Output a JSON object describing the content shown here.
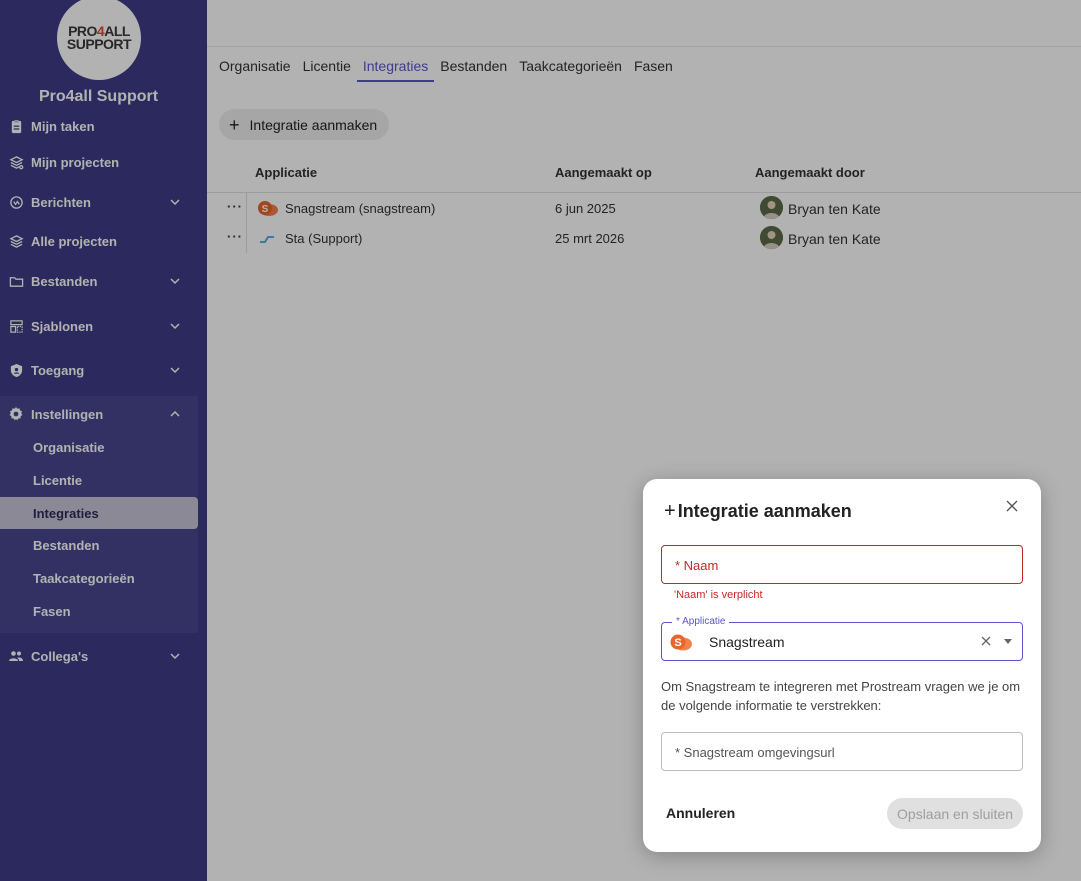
{
  "sidebar": {
    "org_name": "Pro4all Support",
    "logo": {
      "line1_a": "PRO",
      "line1_b": "4",
      "line1_c": "ALL",
      "line2": "SUPPORT"
    },
    "items": [
      {
        "label": "Mijn taken",
        "icon": "clipboard-icon"
      },
      {
        "label": "Mijn projecten",
        "icon": "projects-icon"
      },
      {
        "label": "Berichten",
        "icon": "messages-icon"
      },
      {
        "label": "Alle projecten",
        "icon": "layers-icon"
      },
      {
        "label": "Bestanden",
        "icon": "folder-icon"
      },
      {
        "label": "Sjablonen",
        "icon": "templates-icon"
      },
      {
        "label": "Toegang",
        "icon": "shield-icon"
      },
      {
        "label": "Instellingen",
        "icon": "gear-icon"
      },
      {
        "label": "Collega's",
        "icon": "people-icon"
      }
    ],
    "settings_sub": [
      "Organisatie",
      "Licentie",
      "Integraties",
      "Bestanden",
      "Taakcategorieën",
      "Fasen"
    ]
  },
  "tabs": [
    "Organisatie",
    "Licentie",
    "Integraties",
    "Bestanden",
    "Taakcategorieën",
    "Fasen"
  ],
  "create_button": "Integratie aanmaken",
  "table": {
    "columns": [
      "Applicatie",
      "Aangemaakt op",
      "Aangemaakt door"
    ],
    "rows": [
      {
        "app": "Snagstream (snagstream)",
        "date": "6 jun 2025",
        "creator": "Bryan ten Kate"
      },
      {
        "app": "Sta (Support)",
        "date": "25 mrt 2026",
        "creator": "Bryan ten Kate"
      }
    ]
  },
  "modal": {
    "title": "Integratie aanmaken",
    "name_placeholder": "* Naam",
    "name_error": "'Naam' is verplicht",
    "application_label": "* Applicatie",
    "application_value": "Snagstream",
    "info_text": "Om Snagstream te integreren met Prostream vragen we je om de volgende informatie te verstrekken:",
    "url_placeholder": "* Snagstream omgevingsurl",
    "cancel_label": "Annuleren",
    "save_label": "Opslaan en sluiten"
  },
  "colors": {
    "sidebar": "#3e3b86",
    "accent": "#5b57c9",
    "error": "#c62828",
    "snagstream": "#e8652c"
  }
}
